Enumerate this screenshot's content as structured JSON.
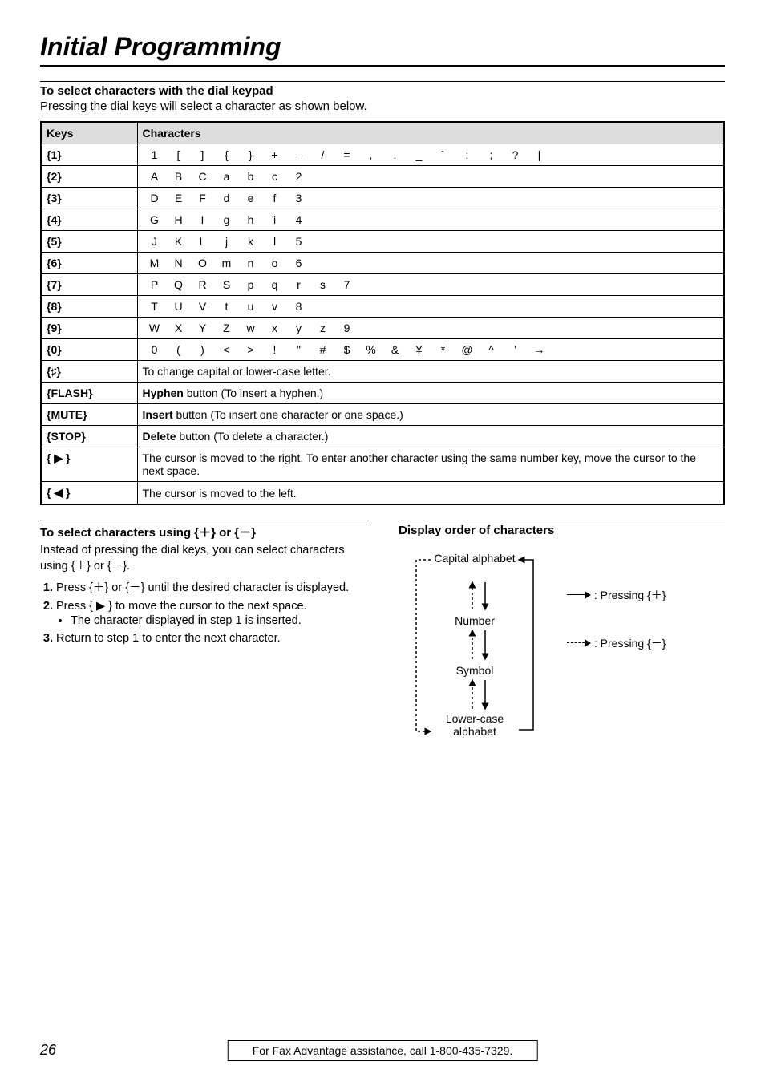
{
  "title": "Initial Programming",
  "section1": {
    "heading": "To select characters with the dial keypad",
    "desc": "Pressing the dial keys will select a character as shown below."
  },
  "table": {
    "head_keys": "Keys",
    "head_chars": "Characters",
    "rows": [
      {
        "key": "{1}",
        "chars": [
          "1",
          "[",
          "]",
          "{",
          "}",
          "+",
          "–",
          "/",
          "=",
          ",",
          ".",
          "_",
          "`",
          ":",
          ";",
          "?",
          "|"
        ]
      },
      {
        "key": "{2}",
        "chars": [
          "A",
          "B",
          "C",
          "a",
          "b",
          "c",
          "2"
        ]
      },
      {
        "key": "{3}",
        "chars": [
          "D",
          "E",
          "F",
          "d",
          "e",
          "f",
          "3"
        ]
      },
      {
        "key": "{4}",
        "chars": [
          "G",
          "H",
          "I",
          "g",
          "h",
          "i",
          "4"
        ]
      },
      {
        "key": "{5}",
        "chars": [
          "J",
          "K",
          "L",
          "j",
          "k",
          "l",
          "5"
        ]
      },
      {
        "key": "{6}",
        "chars": [
          "M",
          "N",
          "O",
          "m",
          "n",
          "o",
          "6"
        ]
      },
      {
        "key": "{7}",
        "chars": [
          "P",
          "Q",
          "R",
          "S",
          "p",
          "q",
          "r",
          "s",
          "7"
        ]
      },
      {
        "key": "{8}",
        "chars": [
          "T",
          "U",
          "V",
          "t",
          "u",
          "v",
          "8"
        ]
      },
      {
        "key": "{9}",
        "chars": [
          "W",
          "X",
          "Y",
          "Z",
          "w",
          "x",
          "y",
          "z",
          "9"
        ]
      },
      {
        "key": "{0}",
        "chars": [
          "0",
          "(",
          ")",
          "<",
          ">",
          "!",
          "\"",
          "#",
          "$",
          "%",
          "&",
          "¥",
          "*",
          "@",
          "^",
          "’",
          "→"
        ]
      }
    ],
    "special": [
      {
        "key": "{♯}",
        "strong": "",
        "desc": "To change capital or lower-case letter."
      },
      {
        "key": "{FLASH}",
        "strong": "Hyphen",
        "desc": " button (To insert a hyphen.)"
      },
      {
        "key": "{MUTE}",
        "strong": "Insert",
        "desc": " button (To insert one character or one space.)"
      },
      {
        "key": "{STOP}",
        "strong": "Delete",
        "desc": " button (To delete a character.)"
      },
      {
        "key": "{ ▶ }",
        "strong": "",
        "desc": "The cursor is moved to the right. To enter another character using the same number key, move the cursor to the next space."
      },
      {
        "key": "{ ◀ }",
        "strong": "",
        "desc": "The cursor is moved to the left."
      }
    ]
  },
  "section2": {
    "heading": "To select characters using {＋} or {－}",
    "intro": "Instead of pressing the dial keys, you can select characters using {＋} or {－}.",
    "steps": [
      {
        "lead": "Press {＋} or {－} until the desired character is displayed.",
        "bullets": []
      },
      {
        "lead": "Press { ▶ } to move the cursor to the next space.",
        "bullets": [
          "The character displayed in step 1 is inserted."
        ]
      },
      {
        "lead": "Return to step 1 to enter the next character.",
        "bullets": []
      }
    ]
  },
  "section3": {
    "heading": "Display order of characters",
    "nodes": {
      "capital": "Capital alphabet",
      "number": "Number",
      "symbol": "Symbol",
      "lower": "Lower-case alphabet"
    },
    "legend_plus": " : Pressing {＋}",
    "legend_minus": " : Pressing {－}"
  },
  "footer": {
    "page": "26",
    "help": "For Fax Advantage assistance, call 1-800-435-7329."
  }
}
